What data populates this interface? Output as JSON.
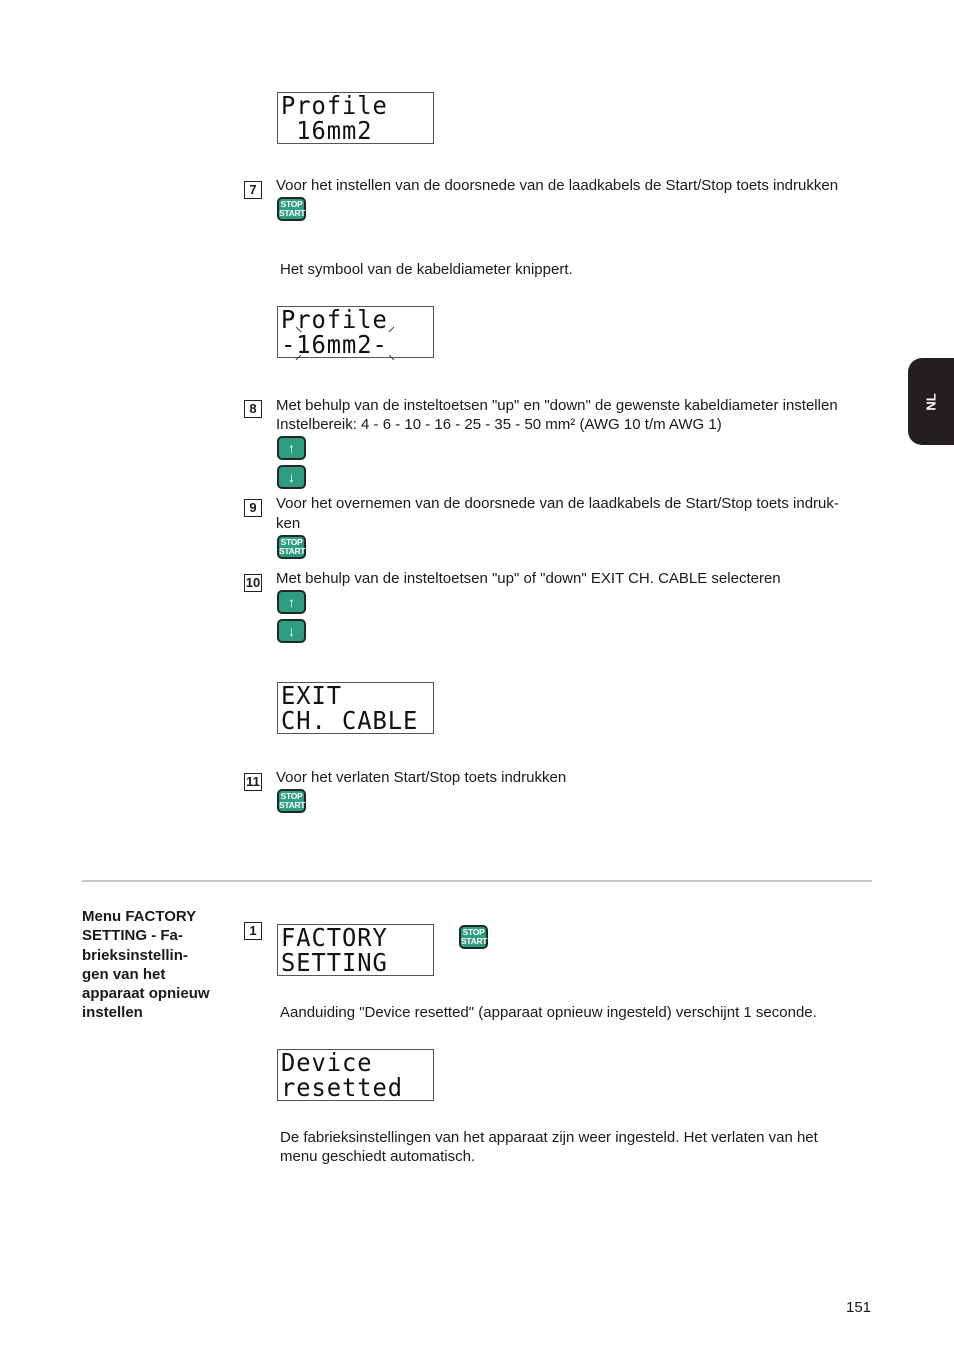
{
  "language_tab": "NL",
  "page_number": "151",
  "lcd_profile_1": {
    "line1": "Profile",
    "line2": " 16mm2"
  },
  "step7": {
    "number": "7",
    "text": "Voor het instellen van de doorsnede van de laadkabels de Start/Stop toets indrukken",
    "key": {
      "top": "STOP",
      "bottom": "START"
    },
    "note": "Het symbool van de kabeldiameter knippert."
  },
  "lcd_profile_2": {
    "line1": "Profile",
    "line2": "-16mm2-"
  },
  "step8": {
    "number": "8",
    "text_line1": "Met behulp van de insteltoetsen \"up\" en \"down\" de gewenste kabeldiameter instellen",
    "text_line2": "Instelbereik: 4 - 6 - 10 - 16 - 25 - 35 - 50 mm²  (AWG 10 t/m  AWG 1)",
    "key_up": "↑",
    "key_down": "↓"
  },
  "step9": {
    "number": "9",
    "text_line1": "Voor het overnemen van de doorsnede van de laadkabels de Start/Stop toets indruk-",
    "text_line2": "ken",
    "key": {
      "top": "STOP",
      "bottom": "START"
    }
  },
  "step10": {
    "number": "10",
    "text": "Met behulp van de insteltoetsen \"up\" of \"down\" EXIT CH. CABLE selecteren",
    "key_up": "↑",
    "key_down": "↓"
  },
  "lcd_exit": {
    "line1": "EXIT",
    "line2": "CH. CABLE"
  },
  "step11": {
    "number": "11",
    "text": "Voor het verlaten Start/Stop toets indrukken",
    "key": {
      "top": "STOP",
      "bottom": "START"
    }
  },
  "factory_section": {
    "heading_lines": [
      "Menu FACTORY",
      "SETTING - Fa-",
      "brieksinstellin-",
      "gen van het",
      "apparaat opnieuw",
      "instellen"
    ],
    "step1_number": "1",
    "lcd_factory": {
      "line1": "FACTORY",
      "line2": "SETTING"
    },
    "key": {
      "top": "STOP",
      "bottom": "START"
    },
    "note": "Aanduiding \"Device resetted\" (apparaat opnieuw ingesteld) verschijnt 1 seconde.",
    "lcd_device": {
      "line1": "Device",
      "line2": "resetted"
    },
    "final_line1": "De fabrieksinstellingen van het apparaat zijn weer ingesteld. Het verlaten van het",
    "final_line2": "menu geschiedt automatisch."
  }
}
